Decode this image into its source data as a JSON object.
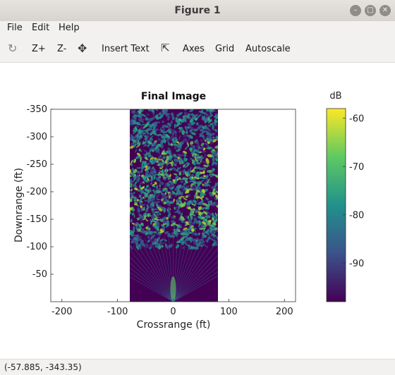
{
  "window": {
    "title": "Figure 1"
  },
  "menu": {
    "file": "File",
    "edit": "Edit",
    "help": "Help"
  },
  "toolbar": {
    "zoom_in": "Z+",
    "zoom_out": "Z-",
    "insert_text": "Insert Text",
    "axes": "Axes",
    "grid": "Grid",
    "autoscale": "Autoscale"
  },
  "status": {
    "coords": "(-57.885, -343.35)"
  },
  "chart_data": {
    "type": "heatmap",
    "title": "Final Image",
    "xlabel": "Crossrange (ft)",
    "ylabel": "Downrange (ft)",
    "xlim": [
      -220,
      220
    ],
    "ylim": [
      0,
      -350
    ],
    "xticks": [
      "-200",
      "-100",
      "0",
      "100",
      "200"
    ],
    "yticks": [
      "-350",
      "-300",
      "-250",
      "-200",
      "-150",
      "-100",
      "-50"
    ],
    "image_extent": {
      "x": [
        -80,
        80
      ],
      "y": [
        0,
        -350
      ]
    },
    "colorbar": {
      "label": "dB",
      "range": [
        -98,
        -58
      ],
      "ticks": [
        "-60",
        "-70",
        "-80",
        "-90"
      ],
      "colormap": "viridis"
    }
  }
}
